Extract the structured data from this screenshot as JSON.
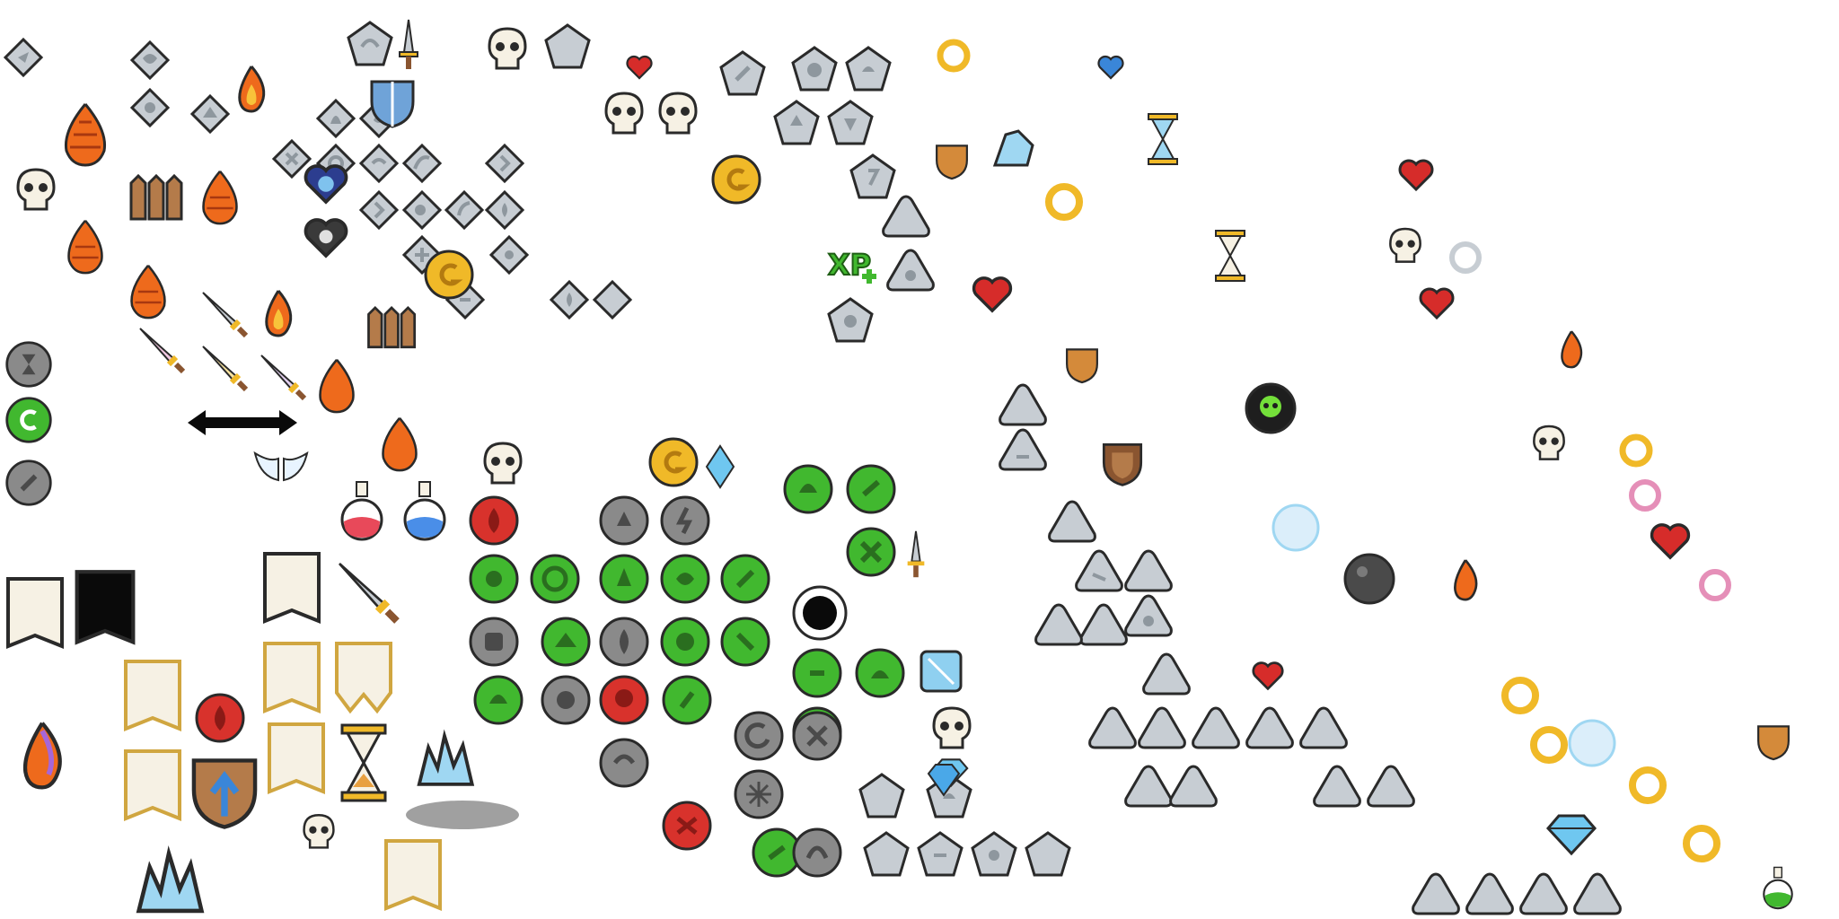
{
  "sheet": {
    "kind": "game icon sprite atlas",
    "text_labels": [
      "XP"
    ]
  },
  "palette": {
    "outline": "#2a2a2a",
    "stone": "#c7cdd3",
    "stone_dark": "#8e979e",
    "badge_green": "#41b82f",
    "badge_red": "#d8322c",
    "badge_gray": "#8a8a8a",
    "gold": "#f0b928",
    "parchment": "#f6f1e4",
    "wood": "#8a5530",
    "fire": "#ee6a1c",
    "ice": "#9fd7f2",
    "heart": "#d62c2a",
    "purple": "#a666d8"
  },
  "groups": [
    {
      "name": "diamond-stone-icon",
      "shape": "diamond",
      "fill": "stone"
    },
    {
      "name": "pentagon-stone-icon",
      "shape": "pentagon",
      "fill": "stone"
    },
    {
      "name": "triangle-stone-icon",
      "shape": "triangle",
      "fill": "stone"
    },
    {
      "name": "green-badge-icon",
      "shape": "circle",
      "fill": "badge_green"
    },
    {
      "name": "gray-badge-icon",
      "shape": "circle",
      "fill": "badge_gray"
    },
    {
      "name": "red-badge-icon",
      "shape": "circle",
      "fill": "badge_red"
    },
    {
      "name": "banner-icon",
      "shape": "banner",
      "fill": "parchment"
    },
    {
      "name": "gold-coin-icon",
      "shape": "coin",
      "fill": "gold"
    },
    {
      "name": "ring-icon",
      "shape": "ring",
      "fill": "gold"
    },
    {
      "name": "heart-icon",
      "shape": "heart",
      "fill": "heart"
    },
    {
      "name": "fire-icon",
      "shape": "flame",
      "fill": "fire"
    },
    {
      "name": "ice-crystal-icon",
      "shape": "crystal",
      "fill": "ice"
    },
    {
      "name": "sword-icon",
      "shape": "sword",
      "fill": "stone"
    },
    {
      "name": "pine-cone-icon",
      "shape": "cone",
      "fill": "fire"
    },
    {
      "name": "shield-icon",
      "shape": "shield",
      "fill": "wood"
    },
    {
      "name": "skull-icon",
      "shape": "skull",
      "fill": "parchment"
    },
    {
      "name": "hourglass-icon",
      "shape": "hourglass",
      "fill": "gold"
    },
    {
      "name": "potion-icon",
      "shape": "potion",
      "fill": "heart"
    },
    {
      "name": "wooden-fence-icon",
      "shape": "fence",
      "fill": "wood"
    },
    {
      "name": "xp-badge-icon",
      "shape": "xp",
      "fill": "badge_green"
    }
  ]
}
